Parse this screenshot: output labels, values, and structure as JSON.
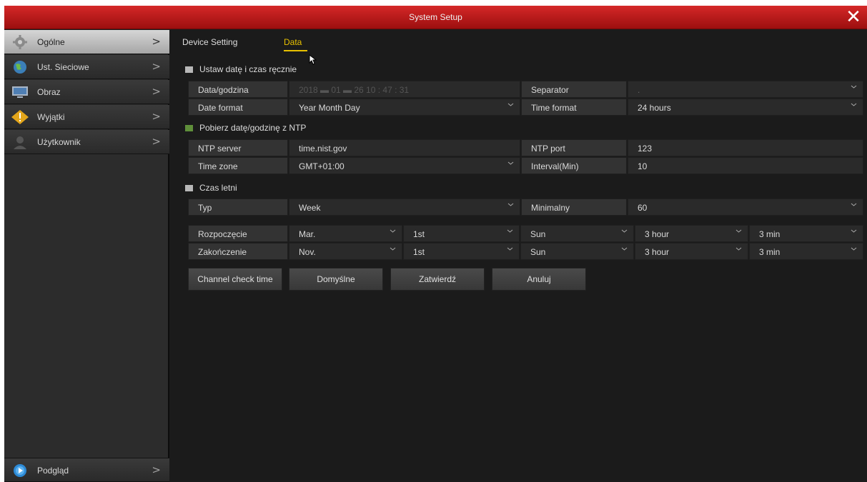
{
  "window": {
    "title": "System Setup"
  },
  "sidebar": {
    "items": [
      {
        "label": "Ogólne",
        "icon": "gear-icon",
        "active": true
      },
      {
        "label": "Ust. Sieciowe",
        "icon": "globe-icon"
      },
      {
        "label": "Obraz",
        "icon": "monitor-icon"
      },
      {
        "label": "Wyjątki",
        "icon": "warning-icon"
      },
      {
        "label": "Użytkownik",
        "icon": "user-icon"
      }
    ],
    "bottom": {
      "label": "Podgląd",
      "icon": "play-icon"
    }
  },
  "tabs": [
    {
      "label": "Device Setting"
    },
    {
      "label": "Data",
      "active": true
    }
  ],
  "manual": {
    "checkbox_label": "Ustaw datę i czas ręcznie",
    "checked": false,
    "datetime_label": "Data/godzina",
    "datetime_value": "2018  ▬  01  ▬  26        10  :  47  :  31",
    "separator_label": "Separator",
    "separator_value": ".",
    "date_format_label": "Date format",
    "date_format_value": "Year Month Day",
    "time_format_label": "Time format",
    "time_format_value": "24 hours"
  },
  "ntp": {
    "checkbox_label": "Pobierz datę/godzinę z NTP",
    "checked": true,
    "server_label": "NTP server",
    "server_value": "time.nist.gov",
    "port_label": "NTP port",
    "port_value": "123",
    "timezone_label": "Time zone",
    "timezone_value": "GMT+01:00",
    "interval_label": "Interval(Min)",
    "interval_value": "10"
  },
  "dst": {
    "checkbox_label": "Czas letni",
    "checked": false,
    "type_label": "Typ",
    "type_value": "Week",
    "min_label": "Minimalny",
    "min_value": "60",
    "start_label": "Rozpoczęcie",
    "start": [
      "Mar.",
      "1st",
      "Sun",
      "3 hour",
      "3 min"
    ],
    "end_label": "Zakończenie",
    "end": [
      "Nov.",
      "1st",
      "Sun",
      "3 hour",
      "3 min"
    ]
  },
  "buttons": {
    "channel_check": "Channel check time",
    "default": "Domyślne",
    "apply": "Zatwierdź",
    "cancel": "Anuluj"
  },
  "colors": {
    "titlebar": "#c21c1c",
    "accent": "#e8c100",
    "background": "#1b1b1b",
    "ntp_check": "#5f8f3a"
  }
}
